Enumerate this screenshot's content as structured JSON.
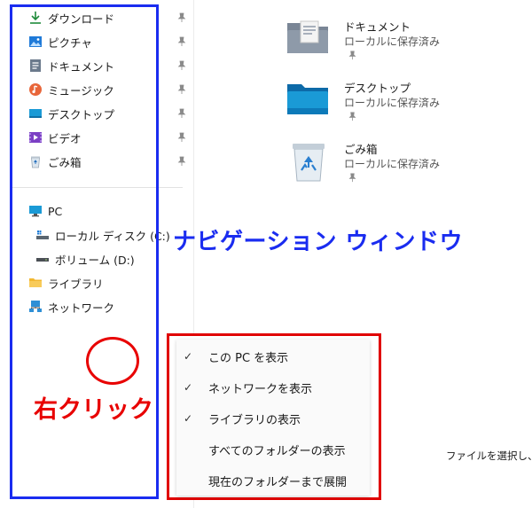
{
  "nav": {
    "quick_access": [
      {
        "label": "ダウンロード",
        "icon": "download-icon"
      },
      {
        "label": "ピクチャ",
        "icon": "pictures-icon"
      },
      {
        "label": "ドキュメント",
        "icon": "documents-icon"
      },
      {
        "label": "ミュージック",
        "icon": "music-icon"
      },
      {
        "label": "デスクトップ",
        "icon": "desktop-icon"
      },
      {
        "label": "ビデオ",
        "icon": "videos-icon"
      },
      {
        "label": "ごみ箱",
        "icon": "recycle-bin-icon"
      }
    ],
    "pc": "PC",
    "local_disk": "ローカル ディスク (C:)",
    "volume": "ボリューム (D:)",
    "library": "ライブラリ",
    "network": "ネットワーク"
  },
  "files": [
    {
      "name": "ドキュメント",
      "status": "ローカルに保存済み",
      "icon": "documents-folder-icon"
    },
    {
      "name": "デスクトップ",
      "status": "ローカルに保存済み",
      "icon": "desktop-folder-icon"
    },
    {
      "name": "ごみ箱",
      "status": "ローカルに保存済み",
      "icon": "recycle-bin-icon"
    }
  ],
  "annotations": {
    "nav_pane": "ナビゲーション ウィンドウ",
    "right_click": "右クリック"
  },
  "context_menu": [
    {
      "label": "この PC を表示",
      "checked": true
    },
    {
      "label": "ネットワークを表示",
      "checked": true
    },
    {
      "label": "ライブラリの表示",
      "checked": true
    },
    {
      "label": "すべてのフォルダーの表示",
      "checked": false
    },
    {
      "label": "現在のフォルダーまで展開",
      "checked": false
    }
  ],
  "status_text": "ファイルを選択し、",
  "colors": {
    "annotation_blue": "#1a2cf0",
    "annotation_red": "#e80000"
  }
}
